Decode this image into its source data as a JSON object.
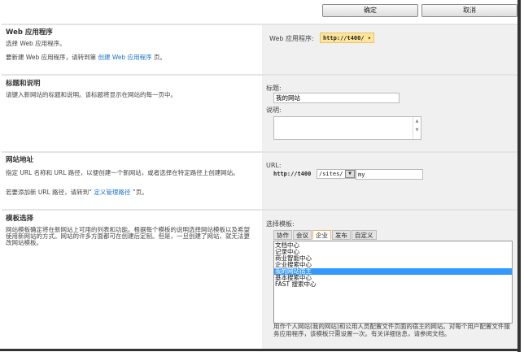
{
  "buttons": {
    "ok": "确定",
    "cancel": "取消"
  },
  "webapp": {
    "heading": "Web 应用程序",
    "line1": "选择 Web 应用程序。",
    "line2_pre": "要新建 Web 应用程序，请转到第 ",
    "line2_link": "创建 Web 应用程序",
    "line2_post": " 页。",
    "label": "Web 应用程序:",
    "value": "http://t400/"
  },
  "title": {
    "heading": "标题和说明",
    "desc": "请键入新网站的标题和说明。该标题将显示在网站的每一页中。",
    "title_label": "标题:",
    "title_value": "我的网站",
    "desc_label": "说明:",
    "desc_value": ""
  },
  "url": {
    "heading": "网站地址",
    "desc": "指定 URL 名称和 URL 路径，以便创建一个新网站，或者选择在特定路径上创建网站。",
    "line2_pre": "若要添加新 URL 路径，请转到“ ",
    "line2_link": "定义管理路径",
    "line2_post": " ”页。",
    "label": "URL:",
    "prefix": "http://t400",
    "path": "/sites/",
    "name": "my"
  },
  "template": {
    "heading": "模板选择",
    "desc": "网站模板确定将在新网站上可用的列表和功能。根据每个模板的说明选择网站模板以及希望使用新网站的方式。网站的许多方面都可在创建后定制。但是，一旦创建了网站，就无法更改网站模板。",
    "label": "选择模板:",
    "tabs": [
      "协作",
      "会议",
      "企业",
      "发布",
      "自定义"
    ],
    "active_tab": "企业",
    "items": [
      "文档中心",
      "记录中心",
      "商业智能中心",
      "企业搜索中心",
      "我的网站宿主",
      "基本搜索中心",
      "FAST 搜索中心"
    ],
    "selected": "我的网站宿主",
    "item_desc": "用作个人网站(我的网站)和公用人员配置文件页面的宿主的网站。对每个用户配置文件服务应用程序，该模板只需设置一次。有关详细信息，请参阅文档。"
  }
}
